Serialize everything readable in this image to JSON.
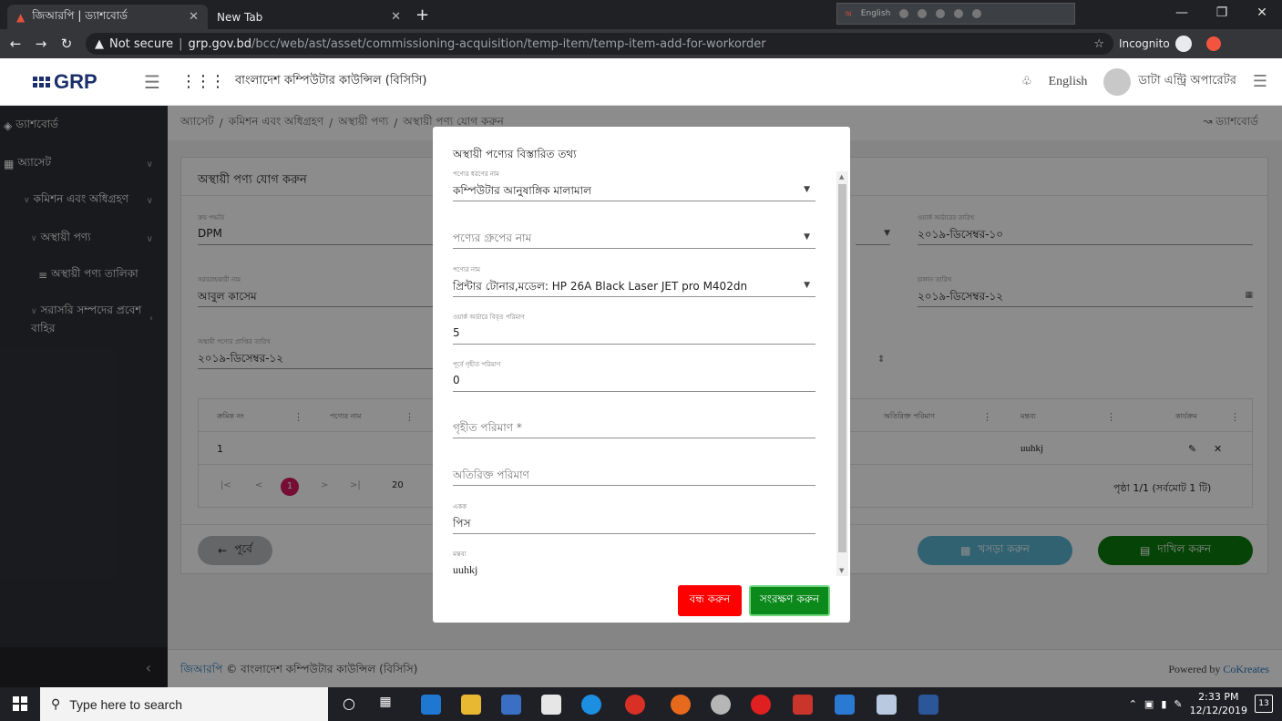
{
  "browser": {
    "tabs": [
      {
        "title": "জিআরপি | ড্যাশবোর্ড"
      },
      {
        "title": "New Tab"
      }
    ],
    "lang_strip_label": "English",
    "security_label": "Not secure",
    "url_host": "grp.gov.bd",
    "url_path": "/bcc/web/ast/asset/commissioning-acquisition/temp-item/temp-item-add-for-workorder",
    "incognito_label": "Incognito"
  },
  "header": {
    "logo_text": "GRP",
    "org_name": "বাংলাদেশ কম্পিউটার কাউন্সিল (বিসিসি)",
    "language": "English",
    "user_role": "ডাটা এন্ট্রি অপারেটর"
  },
  "sidebar": {
    "items": [
      {
        "label": "ড্যাশবোর্ড"
      },
      {
        "label": "অ্যাসেট"
      },
      {
        "label": "কমিশন এবং অধিগ্রহণ"
      },
      {
        "label": "অস্থায়ী পণ্য"
      },
      {
        "label": "অস্থায়ী পণ্য তালিকা"
      },
      {
        "label": "সরাসরি সম্পদের প্রবেশ"
      },
      {
        "label": "বাহির"
      }
    ]
  },
  "breadcrumb": {
    "items": [
      "অ্যাসেট",
      "কমিশন এবং অধিগ্রহণ",
      "অস্থায়ী পণ্য",
      "অস্থায়ী পণ্য যোগ করুন"
    ],
    "sep": "/",
    "right_label": "ড্যাশবোর্ড"
  },
  "form": {
    "title": "অস্থায়ী পণ্য যোগ করুন",
    "purchase_method": {
      "label": "ক্রয় পদ্ধতি",
      "value": "DPM"
    },
    "workorder_date": {
      "label": "ওয়ার্ক অর্ডারের তারিখ",
      "value": "২০১৯-ডিসেম্বর-১০"
    },
    "supplier": {
      "label": "সরবরাহকারী নাম",
      "value": "আবুল কাসেম"
    },
    "challan_date": {
      "label": "চালান তারিখ",
      "value": "২০১৯-ডিসেম্বর-১২"
    },
    "receive_date": {
      "label": "অস্থায়ী পণ্যের প্রাপ্তির তারিখ",
      "value": "২০১৯-ডিসেম্বর-১২"
    }
  },
  "table": {
    "headers": [
      "ক্রমিক নং",
      "পণ্যের নাম",
      "অতিরিক্ত পরিমাণ",
      "মন্তব্য",
      "কার্যক্রম"
    ],
    "rows": [
      {
        "serial": "1",
        "remark": "uuhkj"
      }
    ],
    "pagination": {
      "first": "|<",
      "prev": "<",
      "current": "1",
      "next": ">",
      "last": ">|",
      "page_size": "20",
      "summary": "পৃষ্ঠা 1/1 (সর্বমোট 1 টি)"
    }
  },
  "footer_buttons": {
    "prev": "পূর্বে",
    "draft": "খসড়া করুন",
    "submit": "দাখিল করুন"
  },
  "app_footer": {
    "brand": "জিআরপি",
    "copyright": "© বাংলাদেশ কম্পিউটার কাউন্সিল (বিসিসি)",
    "powered_prefix": "Powered by",
    "powered_brand": "CoKreates"
  },
  "modal": {
    "title": "অস্থায়ী পণ্যের বিস্তারিত তথ্য",
    "fields": {
      "item_type": {
        "label": "পণ্যের ধরণের নাম",
        "value": "কম্পিউটার আনুষাঙ্গিক মালামাল"
      },
      "item_group": {
        "placeholder": "পণ্যের গ্রুপের নাম"
      },
      "item_name": {
        "label": "পণ্যের নাম",
        "value": "প্রিন্টার টোনার,মডেল: HP 26A Black Laser JET pro M402dn"
      },
      "ordered_qty": {
        "label": "ওয়ার্ক অর্ডারে বিবৃত পরিমাণ",
        "value": "5"
      },
      "prev_received_qty": {
        "label": "পূর্বে গৃহীত পরিমাণ",
        "value": "0"
      },
      "received_qty": {
        "placeholder": "গৃহীত পরিমাণ *"
      },
      "extra_qty": {
        "placeholder": "অতিরিক্ত পরিমাণ"
      },
      "unit": {
        "label": "একক",
        "value": "পিস"
      },
      "remark": {
        "label": "মন্তব্য",
        "value": "uuhkj"
      }
    },
    "close_button": "বন্ধ করুন",
    "save_button": "সংরক্ষণ করুন"
  },
  "taskbar": {
    "search_placeholder": "Type here to search",
    "time": "2:33 PM",
    "date": "12/12/2019",
    "notif_count": "13"
  },
  "colors": {
    "sidebar_bg": "#2f3136",
    "submit_green": "#0b7a0b",
    "draft_blue": "#5ab3cf",
    "close_red": "#ff0000",
    "pager_active": "#d81b60"
  }
}
